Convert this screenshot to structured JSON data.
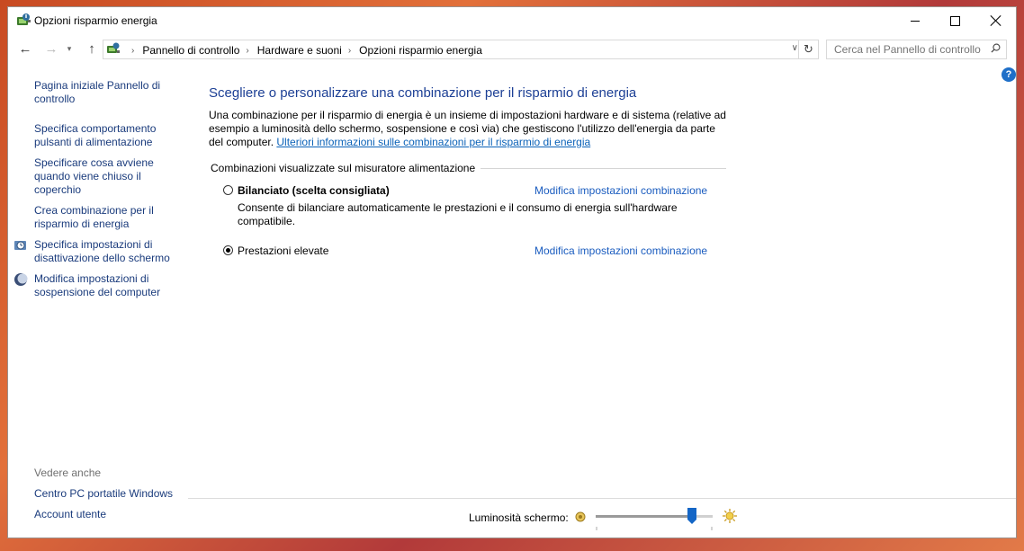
{
  "window": {
    "title": "Opzioni risparmio energia",
    "controls": {
      "minimize": "minimize",
      "maximize": "maximize",
      "close": "close"
    }
  },
  "address": {
    "breadcrumbs": [
      "Pannello di controllo",
      "Hardware e suoni",
      "Opzioni risparmio energia"
    ],
    "search_placeholder": "Cerca nel Pannello di controllo"
  },
  "sidebar": {
    "home": "Pagina iniziale Pannello di controllo",
    "links": [
      "Specifica comportamento pulsanti di alimentazione",
      "Specificare cosa avviene quando viene chiuso il coperchio",
      "Crea combinazione per il risparmio di energia",
      "Specifica impostazioni di disattivazione dello schermo",
      "Modifica impostazioni di sospensione del computer"
    ],
    "see_also": {
      "heading": "Vedere anche",
      "links": [
        "Centro PC portatile Windows",
        "Account utente"
      ]
    }
  },
  "main": {
    "title": "Scegliere o personalizzare una combinazione per il risparmio di energia",
    "description": "Una combinazione per il risparmio di energia è un insieme di impostazioni hardware e di sistema (relative ad esempio a luminosità dello schermo, sospensione e così via) che gestiscono l'utilizzo dell'energia da parte del computer.",
    "more_info_link": "Ulteriori informazioni sulle combinazioni per il risparmio di energia",
    "group_label": "Combinazioni visualizzate sul misuratore alimentazione",
    "plans": [
      {
        "name": "Bilanciato (scelta consigliata)",
        "selected": false,
        "link": "Modifica impostazioni combinazione",
        "description": "Consente di bilanciare automaticamente le prestazioni e il consumo di energia sull'hardware compatibile."
      },
      {
        "name": "Prestazioni elevate",
        "selected": true,
        "link": "Modifica impostazioni combinazione",
        "description": ""
      }
    ]
  },
  "brightness": {
    "label": "Luminosità schermo:",
    "level_fraction": 0.82
  },
  "colors": {
    "link": "#1a5cbf",
    "title": "#1c3f95",
    "help": "#1e6fc8",
    "slider_thumb": "#1466c6"
  }
}
